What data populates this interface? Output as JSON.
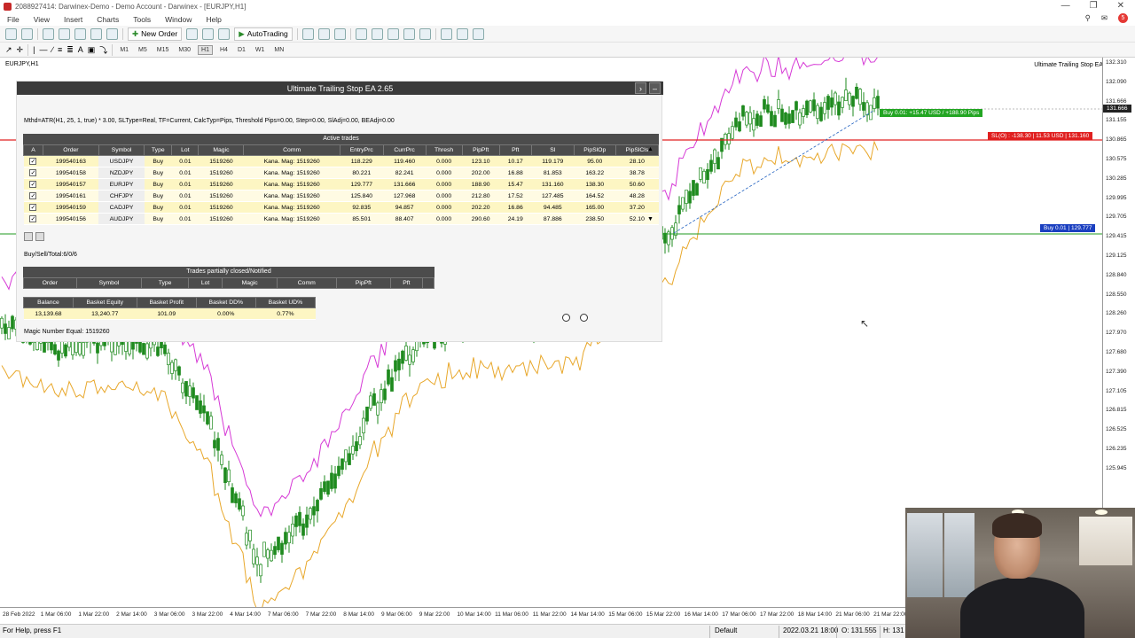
{
  "window": {
    "title": "2088927414: Darwinex-Demo - Demo Account - Darwinex - [EURJPY,H1]"
  },
  "menu": [
    "File",
    "View",
    "Insert",
    "Charts",
    "Tools",
    "Window",
    "Help"
  ],
  "notifications_count": "5",
  "toolbar": {
    "new_order": "New Order",
    "autotrading": "AutoTrading",
    "timeframes": [
      "M1",
      "M5",
      "M15",
      "M30",
      "H1",
      "H4",
      "D1",
      "W1",
      "MN"
    ],
    "active_timeframe": "H1"
  },
  "chart": {
    "symbol_label": "EURJPY,H1",
    "ea_label": "Ultimate Trailing Stop EA",
    "price_ticks": [
      "132.310",
      "132.090",
      "131.666",
      "131.155",
      "130.865",
      "130.575",
      "130.285",
      "129.995",
      "129.705",
      "129.415",
      "129.125",
      "128.840",
      "128.550",
      "128.260",
      "127.970",
      "127.680",
      "127.390",
      "127.105",
      "126.815",
      "126.525",
      "126.235",
      "125.945"
    ],
    "current_price": "131.666",
    "time_ticks": [
      "28 Feb 2022",
      "1 Mar 06:00",
      "1 Mar 22:00",
      "2 Mar 14:00",
      "3 Mar 06:00",
      "3 Mar 22:00",
      "4 Mar 14:00",
      "7 Mar 06:00",
      "7 Mar 22:00",
      "8 Mar 14:00",
      "9 Mar 06:00",
      "9 Mar 22:00",
      "10 Mar 14:00",
      "11 Mar 06:00",
      "11 Mar 22:00",
      "14 Mar 14:00",
      "15 Mar 06:00",
      "15 Mar 22:00",
      "16 Mar 14:00",
      "17 Mar 06:00",
      "17 Mar 22:00",
      "18 Mar 14:00",
      "21 Mar 06:00",
      "21 Mar 22:00"
    ],
    "tags": {
      "buy_profit": "Buy 0.01: +15.47 USD / +188.90 Pips",
      "sl": "SL(O) : -138.30 | 11.53 USD | 131.160",
      "buy_entry": "Buy 0.01 | 129.777"
    },
    "colors": {
      "upper_band": "#d63ad6",
      "lower_band": "#e8a72a",
      "candles": "#1e8a1e",
      "sl_line": "#e02020",
      "entry_line": "#1f9a1f"
    }
  },
  "ea_panel": {
    "title": "Ultimate Trailing Stop EA 2.65",
    "description": "Mthd=ATR(H1, 25, 1, true) * 3.00, SLType=Real, TF=Current, CalcTyp=Pips, Threshold Pips=0.00, Step=0.00, SlAdj=0.00, BEAdj=0.00",
    "active_trades": {
      "caption": "Active trades",
      "headers": [
        "A",
        "Order",
        "Symbol",
        "Type",
        "Lot",
        "Magic",
        "Comm",
        "EntryPrc",
        "CurrPrc",
        "Thresh",
        "PipPft",
        "Pft",
        "Sl",
        "PipSlOp",
        "PipSlCls"
      ],
      "rows": [
        [
          "199540163",
          "USDJPY",
          "Buy",
          "0.01",
          "1519260",
          "Kana. Mag: 1519260",
          "118.229",
          "119.460",
          "0.000",
          "123.10",
          "10.17",
          "119.179",
          "95.00",
          "28.10"
        ],
        [
          "199540158",
          "NZDJPY",
          "Buy",
          "0.01",
          "1519260",
          "Kana. Mag: 1519260",
          "80.221",
          "82.241",
          "0.000",
          "202.00",
          "16.88",
          "81.853",
          "163.22",
          "38.78"
        ],
        [
          "199540157",
          "EURJPY",
          "Buy",
          "0.01",
          "1519260",
          "Kana. Mag: 1519260",
          "129.777",
          "131.666",
          "0.000",
          "188.90",
          "15.47",
          "131.160",
          "138.30",
          "50.60"
        ],
        [
          "199540161",
          "CHFJPY",
          "Buy",
          "0.01",
          "1519260",
          "Kana. Mag: 1519260",
          "125.840",
          "127.968",
          "0.000",
          "212.80",
          "17.52",
          "127.485",
          "164.52",
          "48.28"
        ],
        [
          "199540159",
          "CADJPY",
          "Buy",
          "0.01",
          "1519260",
          "Kana. Mag: 1519260",
          "92.835",
          "94.857",
          "0.000",
          "202.20",
          "16.86",
          "94.485",
          "165.00",
          "37.20"
        ],
        [
          "199540156",
          "AUDJPY",
          "Buy",
          "0.01",
          "1519260",
          "Kana. Mag: 1519260",
          "85.501",
          "88.407",
          "0.000",
          "290.60",
          "24.19",
          "87.886",
          "238.50",
          "52.10"
        ]
      ]
    },
    "buy_sell_total": "Buy/Sell/Total:6/0/6",
    "partial": {
      "caption": "Trades partially closed/Notified",
      "headers": [
        "Order",
        "Symbol",
        "Type",
        "Lot",
        "Magic",
        "Comm",
        "PipPft",
        "Pft"
      ]
    },
    "basket": {
      "headers": [
        "Balance",
        "Basket Equity",
        "Basket Profit",
        "Basket DD%",
        "Basket UD%"
      ],
      "values": [
        "13,139.68",
        "13,240.77",
        "101.09",
        "0.00%",
        "0.77%"
      ]
    },
    "magic_equal": "Magic Number Equal: 1519260"
  },
  "status": {
    "help": "For Help, press F1",
    "profile": "Default",
    "datetime": "2022.03.21 18:00",
    "open": "O: 131.555",
    "high": "H: 131"
  }
}
